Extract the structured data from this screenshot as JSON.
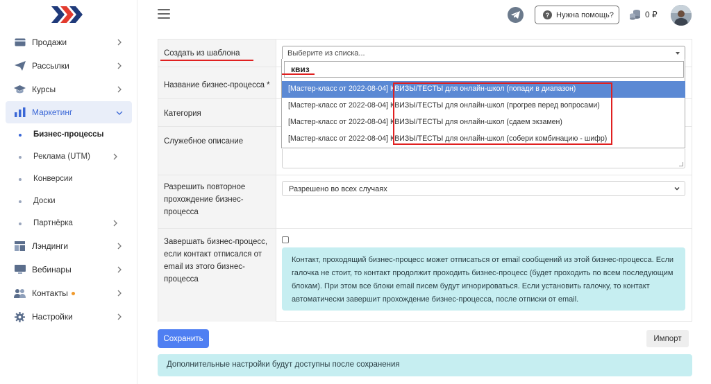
{
  "sidebar": {
    "items": [
      {
        "label": "Продажи",
        "icon": "card-icon"
      },
      {
        "label": "Рассылки",
        "icon": "paper-plane-icon"
      },
      {
        "label": "Курсы",
        "icon": "graduation-cap-icon"
      },
      {
        "label": "Маркетинг",
        "icon": "chart-icon",
        "active": true
      },
      {
        "label": "Лэндинги",
        "icon": "layout-icon"
      },
      {
        "label": "Вебинары",
        "icon": "monitor-icon"
      },
      {
        "label": "Контакты",
        "icon": "users-icon",
        "badge": true
      },
      {
        "label": "Настройки",
        "icon": "gear-icon"
      }
    ],
    "sub_items": [
      {
        "label": "Бизнес-процессы",
        "active": true
      },
      {
        "label": "Реклама (UTM)"
      },
      {
        "label": "Конверсии"
      },
      {
        "label": "Доски"
      },
      {
        "label": "Партнёрка"
      }
    ]
  },
  "topbar": {
    "help_label": "Нужна помощь?",
    "help_q": "?",
    "balance": "0 ₽"
  },
  "form": {
    "template_label": "Создать из шаблона",
    "template_placeholder": "Выберите из списка...",
    "search_value": "квиз",
    "options": [
      {
        "prefix": "[Мастер-класс от 2022-08-04]",
        "name": "КВИЗЫ/ТЕСТЫ для онлайн-школ (попади в диапазон)"
      },
      {
        "prefix": "[Мастер-класс от 2022-08-04]",
        "name": "КВИЗЫ/ТЕСТЫ для онлайн-школ (прогрев перед вопросами)"
      },
      {
        "prefix": "[Мастер-класс от 2022-08-04]",
        "name": "КВИЗЫ/ТЕСТЫ для онлайн-школ (сдаем экзамен)"
      },
      {
        "prefix": "[Мастер-класс от 2022-08-04]",
        "name": "КВИЗЫ/ТЕСТЫ для онлайн-школ (собери комбинацию - шифр)"
      }
    ],
    "name_label": "Название бизнес-процесса *",
    "category_label": "Категория",
    "description_label": "Служебное описание",
    "repeat_label": "Разрешить повторное прохождение бизнес-процесса",
    "repeat_value": "Разрешено во всех случаях",
    "unsub_label": "Завершать бизнес-процесс, если контакт отписался от email из этого бизнес-процесса",
    "unsub_info": "Контакт, проходящий бизнес-процесс может отписаться от email сообщений из этой бизнес-процесса. Если галочка не стоит, то контакт продолжит проходить бизнес-процесс (будет проходить по всем последующим блокам). При этом все блоки email писем будут игнорироваться. Если установить галочку, то контакт автоматически завершит прохождение бизнес-процесса, после отписки от email."
  },
  "actions": {
    "save_label": "Сохранить",
    "import_label": "Импорт",
    "notice": "Дополнительные настройки будут доступны после сохранения"
  },
  "colors": {
    "accent": "#4f7ff2",
    "highlight": "#5b89d4",
    "info_bg": "#c6eef1",
    "annotation_red": "#e02020"
  }
}
